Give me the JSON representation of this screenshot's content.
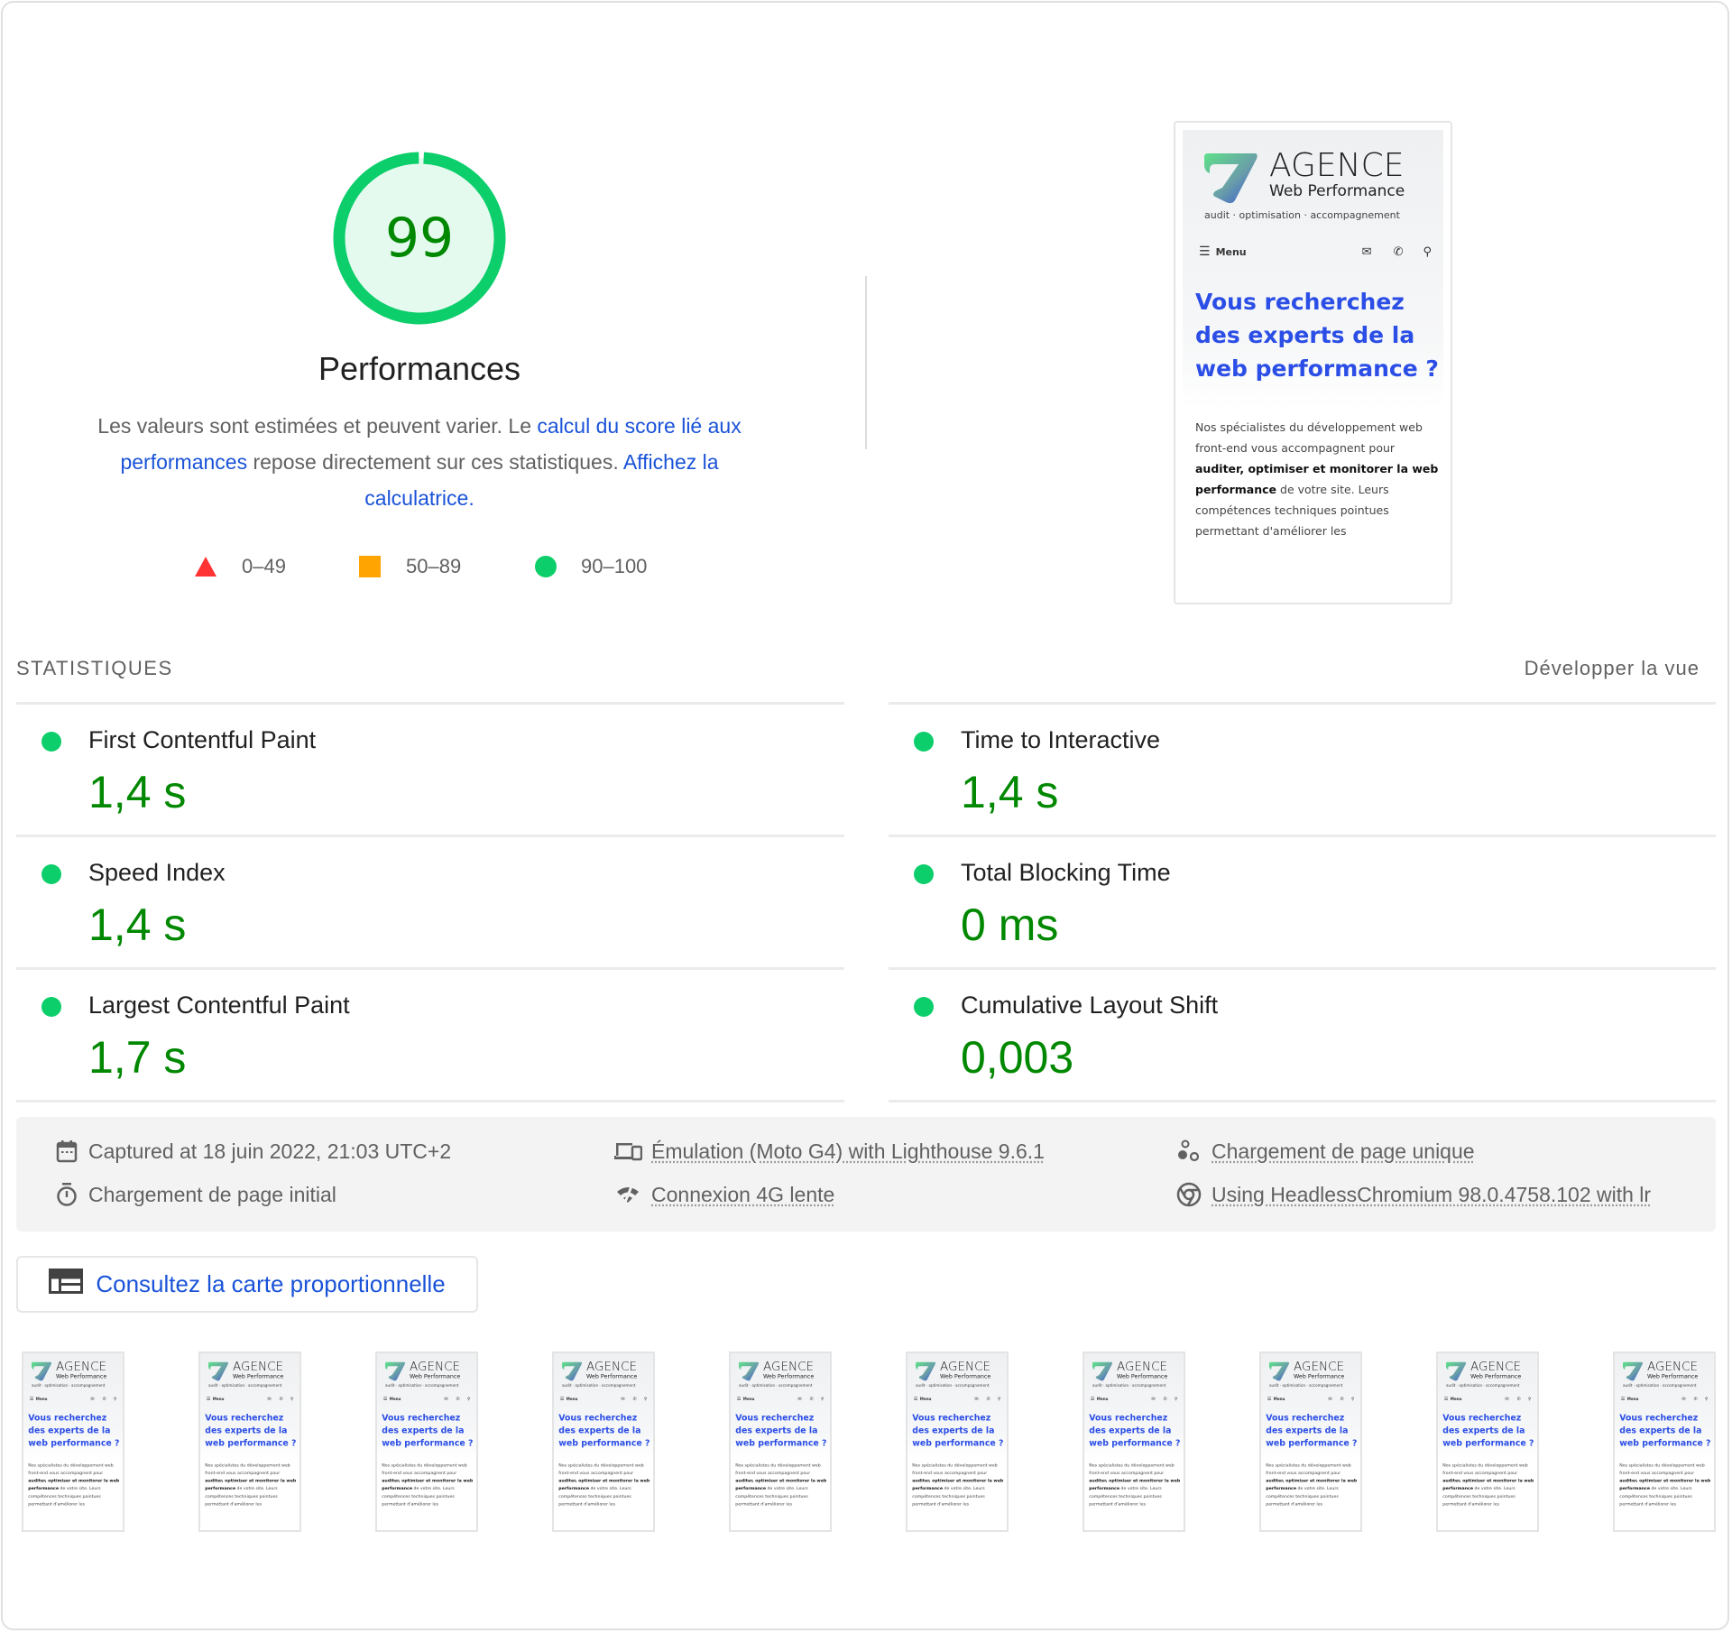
{
  "score": {
    "value": 99,
    "fraction": 0.99,
    "title": "Performances",
    "colors": {
      "pass": "#0cce6b",
      "pass_text": "#008800",
      "pass_bg": "#e5faef",
      "average": "#ffa400",
      "fail": "#ff3333",
      "link": "#1a53d8"
    }
  },
  "description": {
    "text1": "Les valeurs sont estimées et peuvent varier. Le ",
    "link1": "calcul du score lié aux performances",
    "text2": " repose directement sur ces statistiques. ",
    "link2": "Affichez la calculatrice."
  },
  "legend": [
    {
      "shape": "triangle-icon",
      "range": "0–49"
    },
    {
      "shape": "square-icon",
      "range": "50–89"
    },
    {
      "shape": "circle-icon",
      "range": "90–100"
    }
  ],
  "screenshot": {
    "brand_line1": "AGENCE",
    "brand_line2": "Web Performance",
    "tagline": "audit · optimisation · accompagnement",
    "menu_label": "Menu",
    "headline": "Vous recherchez des experts de la web performance ?",
    "para_1": "Nos spécialistes du développement web front-end vous accompagnent pour ",
    "para_bold": "auditer, optimiser et monitorer la web performance",
    "para_2": " de votre site. Leurs compétences techniques pointues permettant d'améliorer les"
  },
  "stats": {
    "title": "STATISTIQUES",
    "expand_label": "Développer la vue",
    "metrics": [
      {
        "label": "First Contentful Paint",
        "value": "1,4 s",
        "status": "pass"
      },
      {
        "label": "Time to Interactive",
        "value": "1,4 s",
        "status": "pass"
      },
      {
        "label": "Speed Index",
        "value": "1,4 s",
        "status": "pass"
      },
      {
        "label": "Total Blocking Time",
        "value": "0 ms",
        "status": "pass"
      },
      {
        "label": "Largest Contentful Paint",
        "value": "1,7 s",
        "status": "pass"
      },
      {
        "label": "Cumulative Layout Shift",
        "value": "0,003",
        "status": "pass"
      }
    ]
  },
  "environment": {
    "captured": "Captured at 18 juin 2022, 21:03 UTC+2",
    "initial_load": "Chargement de page initial",
    "emulation": "Émulation (Moto G4) with Lighthouse 9.6.1",
    "network": "Connexion 4G lente",
    "single_load": "Chargement de page unique",
    "browser": "Using HeadlessChromium 98.0.4758.102 with lr"
  },
  "treemap_button": {
    "label": "Consultez la carte proportionnelle"
  },
  "filmstrip": {
    "frame_count": 10
  }
}
